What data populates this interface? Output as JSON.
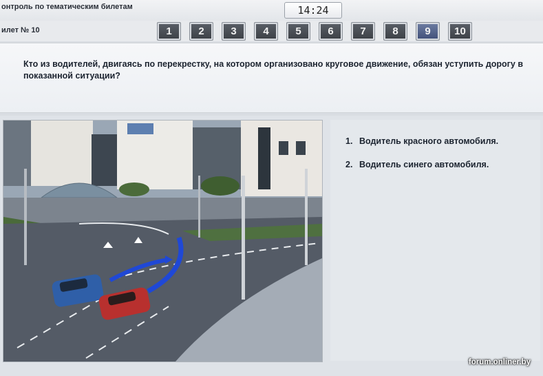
{
  "app": {
    "title": "онтроль по тематическим билетам",
    "timer": "14:24"
  },
  "ticket": {
    "label": "илет № 10",
    "active_question": 9,
    "questions": [
      "1",
      "2",
      "3",
      "4",
      "5",
      "6",
      "7",
      "8",
      "9",
      "10"
    ]
  },
  "question": {
    "text": "Кто из водителей, двигаясь по перекрестку, на котором организовано круговое движение, обязан уступить дорогу в показанной ситуации?"
  },
  "answers": [
    {
      "number": "1.",
      "text": "Водитель красного автомобиля."
    },
    {
      "number": "2.",
      "text": "Водитель синего автомобиля."
    }
  ],
  "watermark": "forum.onliner.by",
  "colors": {
    "active_button": "#4a5a85",
    "button": "#464a50",
    "blue_car": "#2f5fa8",
    "red_car": "#b8302e",
    "path_arrow": "#1f48d6"
  }
}
